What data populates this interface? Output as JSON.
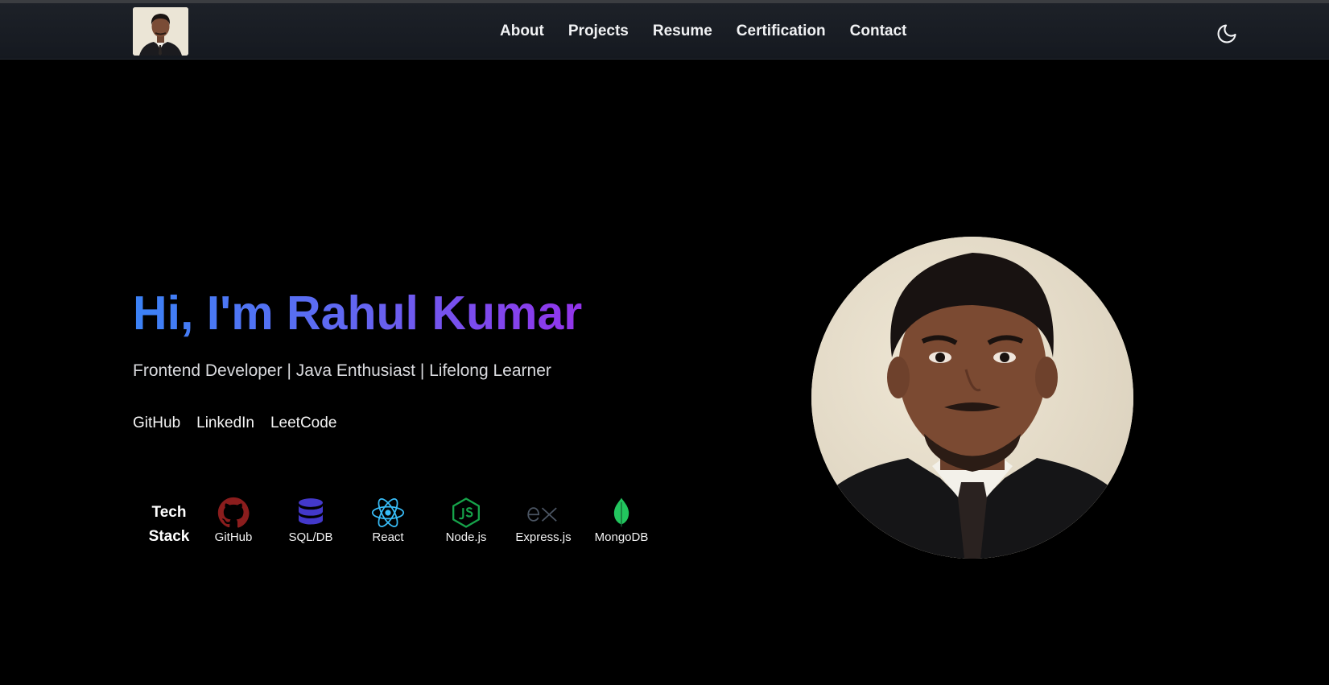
{
  "nav": {
    "links": [
      "About",
      "Projects",
      "Resume",
      "Certification",
      "Contact"
    ]
  },
  "hero": {
    "title": "Hi, I'm Rahul Kumar",
    "subtitle": "Frontend Developer | Java Enthusiast | Lifelong Learner",
    "social": [
      "GitHub",
      "LinkedIn",
      "LeetCode"
    ]
  },
  "tech": {
    "label": "Tech Stack",
    "items": [
      {
        "name": "GitHub",
        "icon": "github-icon",
        "color": "#8b1d1d"
      },
      {
        "name": "SQL/DB",
        "icon": "database-icon",
        "color": "#4338ca"
      },
      {
        "name": "React",
        "icon": "react-icon",
        "color": "#38bdf8"
      },
      {
        "name": "Node.js",
        "icon": "nodejs-icon",
        "color": "#16a34a"
      },
      {
        "name": "Express.js",
        "icon": "expressjs-icon",
        "color": "#4b5563"
      },
      {
        "name": "MongoDB",
        "icon": "mongodb-icon",
        "color": "#22c55e"
      }
    ]
  },
  "colors": {
    "gradient_start": "#3b82f6",
    "gradient_end": "#9333ea",
    "navbar": "#1a1e25",
    "background": "#000000"
  }
}
